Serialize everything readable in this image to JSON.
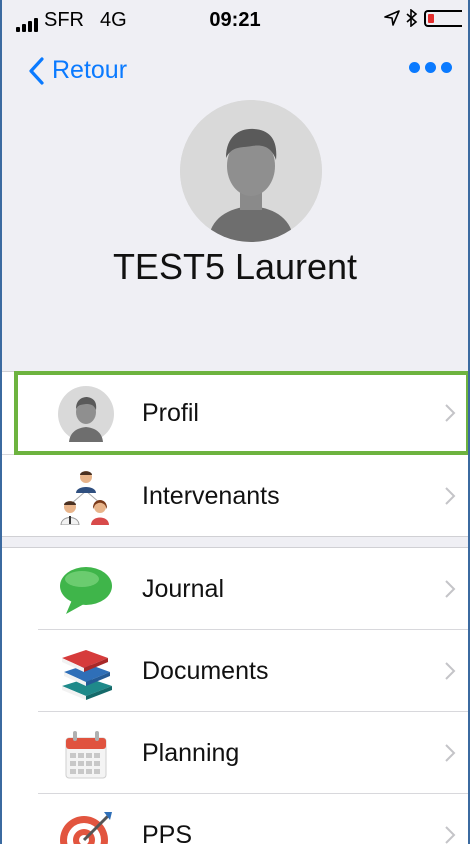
{
  "status_bar": {
    "carrier": "SFR",
    "network": "4G",
    "time": "09:21",
    "icons": [
      "signal-icon",
      "location-arrow-icon",
      "bluetooth-icon",
      "battery-icon"
    ]
  },
  "nav": {
    "back_label": "Retour",
    "more_icon": "ellipsis-icon",
    "accent_color": "#0a7aff"
  },
  "profile": {
    "name": "TEST5 Laurent",
    "avatar_icon": "person-avatar-icon"
  },
  "menu": {
    "group1": [
      {
        "label": "Profil",
        "icon": "person-avatar-icon",
        "selected": true
      },
      {
        "label": "Intervenants",
        "icon": "people-group-icon"
      }
    ],
    "group2": [
      {
        "label": "Journal",
        "icon": "speech-bubble-icon"
      },
      {
        "label": "Documents",
        "icon": "books-icon"
      },
      {
        "label": "Planning",
        "icon": "calendar-icon"
      },
      {
        "label": "PPS",
        "icon": "target-icon"
      }
    ],
    "highlight_color": "#6db33f"
  }
}
